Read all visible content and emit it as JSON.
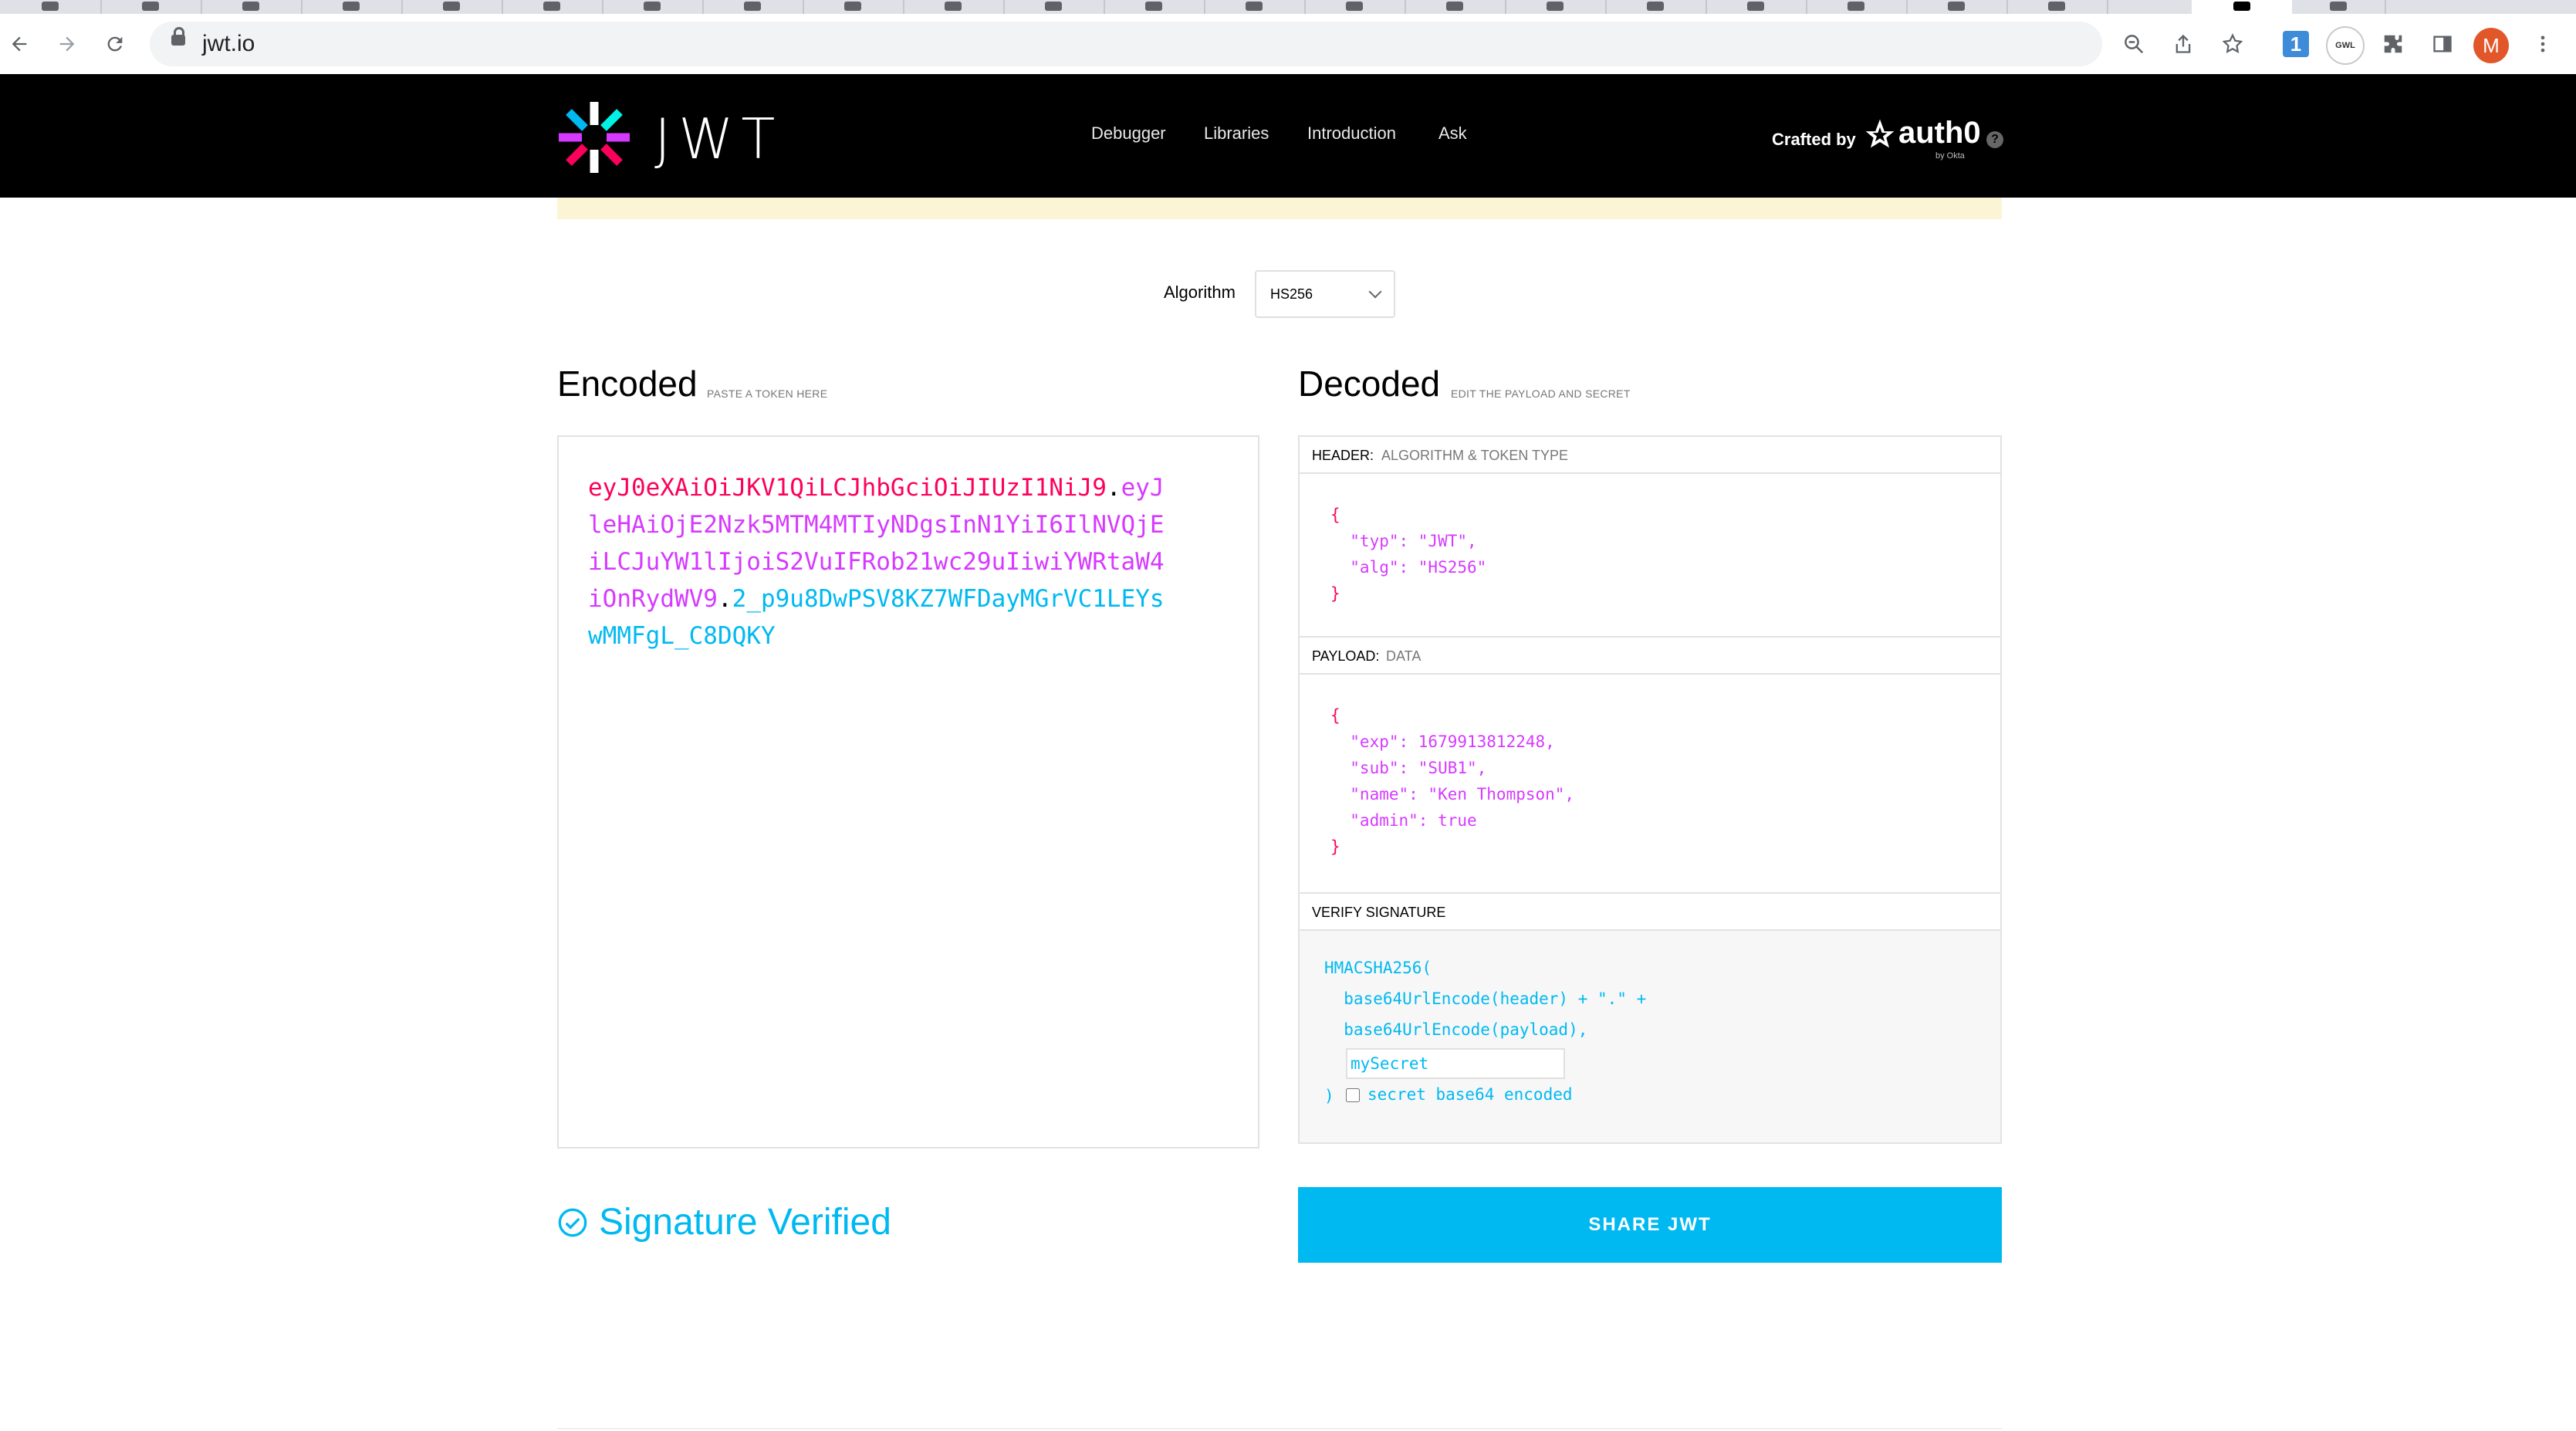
{
  "browser": {
    "url": "jwt.io",
    "back_icon": "arrow-left-icon",
    "forward_icon": "arrow-right-icon",
    "reload_icon": "reload-icon",
    "ext_1p_label": "1",
    "ext_circle_label": "GWL",
    "profile_initial": "M"
  },
  "site": {
    "logo_text": "JWT",
    "nav": [
      "Debugger",
      "Libraries",
      "Introduction",
      "Ask"
    ],
    "crafted_by": "Crafted by",
    "auth0_label": "auth0",
    "auth0_sub": "by Okta",
    "help_label": "?"
  },
  "algorithm": {
    "label": "Algorithm",
    "value": "HS256"
  },
  "encoded": {
    "title": "Encoded",
    "hint": "PASTE A TOKEN HERE",
    "header_part": "eyJ0eXAiOiJKV1QiLCJhbGciOiJIUzI1NiJ9",
    "payload_part": "eyJleHAiOjE2Nzk5MTM4MTIyNDgsInN1YiI6IlNVQjEiLCJuYW1lIjoiS2VuIFRob21wc29uIiwiYWRtaW4iOnRydWV9",
    "signature_part": "2_p9u8DwPSV8KZ7WFDayMGrVC1LEYswMMFgL_C8DQKY",
    "dot": "."
  },
  "decoded": {
    "title": "Decoded",
    "hint": "EDIT THE PAYLOAD AND SECRET",
    "header_section": {
      "key": "HEADER:",
      "sub": "ALGORITHM & TOKEN TYPE"
    },
    "header_json": [
      "{",
      "  \"typ\": \"JWT\",",
      "  \"alg\": \"HS256\"",
      "}"
    ],
    "payload_section": {
      "key": "PAYLOAD:",
      "sub": "DATA"
    },
    "payload_json": [
      "{",
      "  \"exp\": 1679913812248,",
      "  \"sub\": \"SUB1\",",
      "  \"name\": \"Ken Thompson\",",
      "  \"admin\": true",
      "}"
    ],
    "verify_section": {
      "key": "VERIFY SIGNATURE"
    },
    "verify_lines": [
      "HMACSHA256(",
      "  base64UrlEncode(header) + \".\" +",
      "  base64UrlEncode(payload),"
    ],
    "secret_value": "mySecret",
    "close_paren": ")",
    "b64_label": "secret base64 encoded"
  },
  "status": {
    "verified_label": "Signature Verified"
  },
  "share": {
    "label": "SHARE JWT"
  },
  "colors": {
    "header": "#fb015b",
    "payload": "#d63aff",
    "signature": "#00b9f1"
  }
}
